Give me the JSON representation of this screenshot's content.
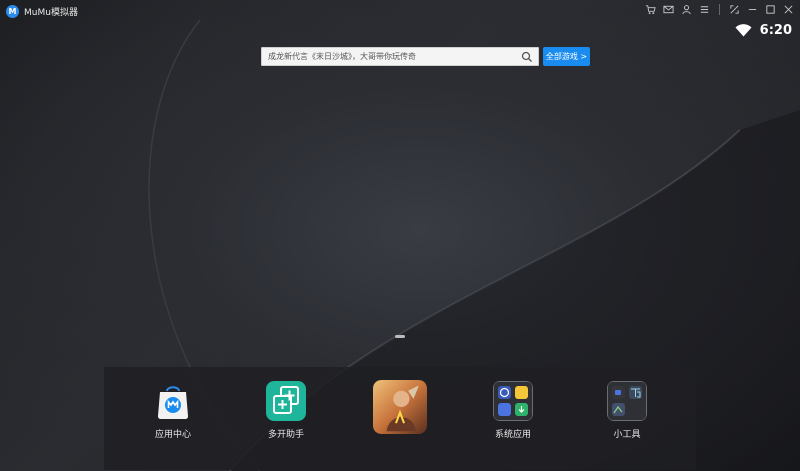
{
  "window": {
    "title": "MuMu模拟器",
    "logo_letter": "M",
    "title_icons": [
      "cart-icon",
      "mail-icon",
      "user-icon",
      "menu-icon",
      "screenshot-icon",
      "minimize-icon",
      "maximize-icon",
      "close-icon"
    ]
  },
  "statusbar": {
    "time": "6:20",
    "wifi": "wifi-icon"
  },
  "search": {
    "text": "成龙新代言《末日沙城》，大哥带你玩传奇",
    "button": "全部游戏 >"
  },
  "dock": {
    "items": [
      {
        "label": "应用中心",
        "icon": "app-center-icon"
      },
      {
        "label": "多开助手",
        "icon": "multi-instance-icon"
      },
      {
        "label": "",
        "icon": "game-icon"
      },
      {
        "label": "系统应用",
        "icon": "system-apps-folder-icon"
      },
      {
        "label": "小工具",
        "icon": "tools-folder-icon"
      }
    ]
  },
  "colors": {
    "accent": "#1a8cf0",
    "background": "#1b1c20",
    "multi_green": "#1fb59a"
  }
}
